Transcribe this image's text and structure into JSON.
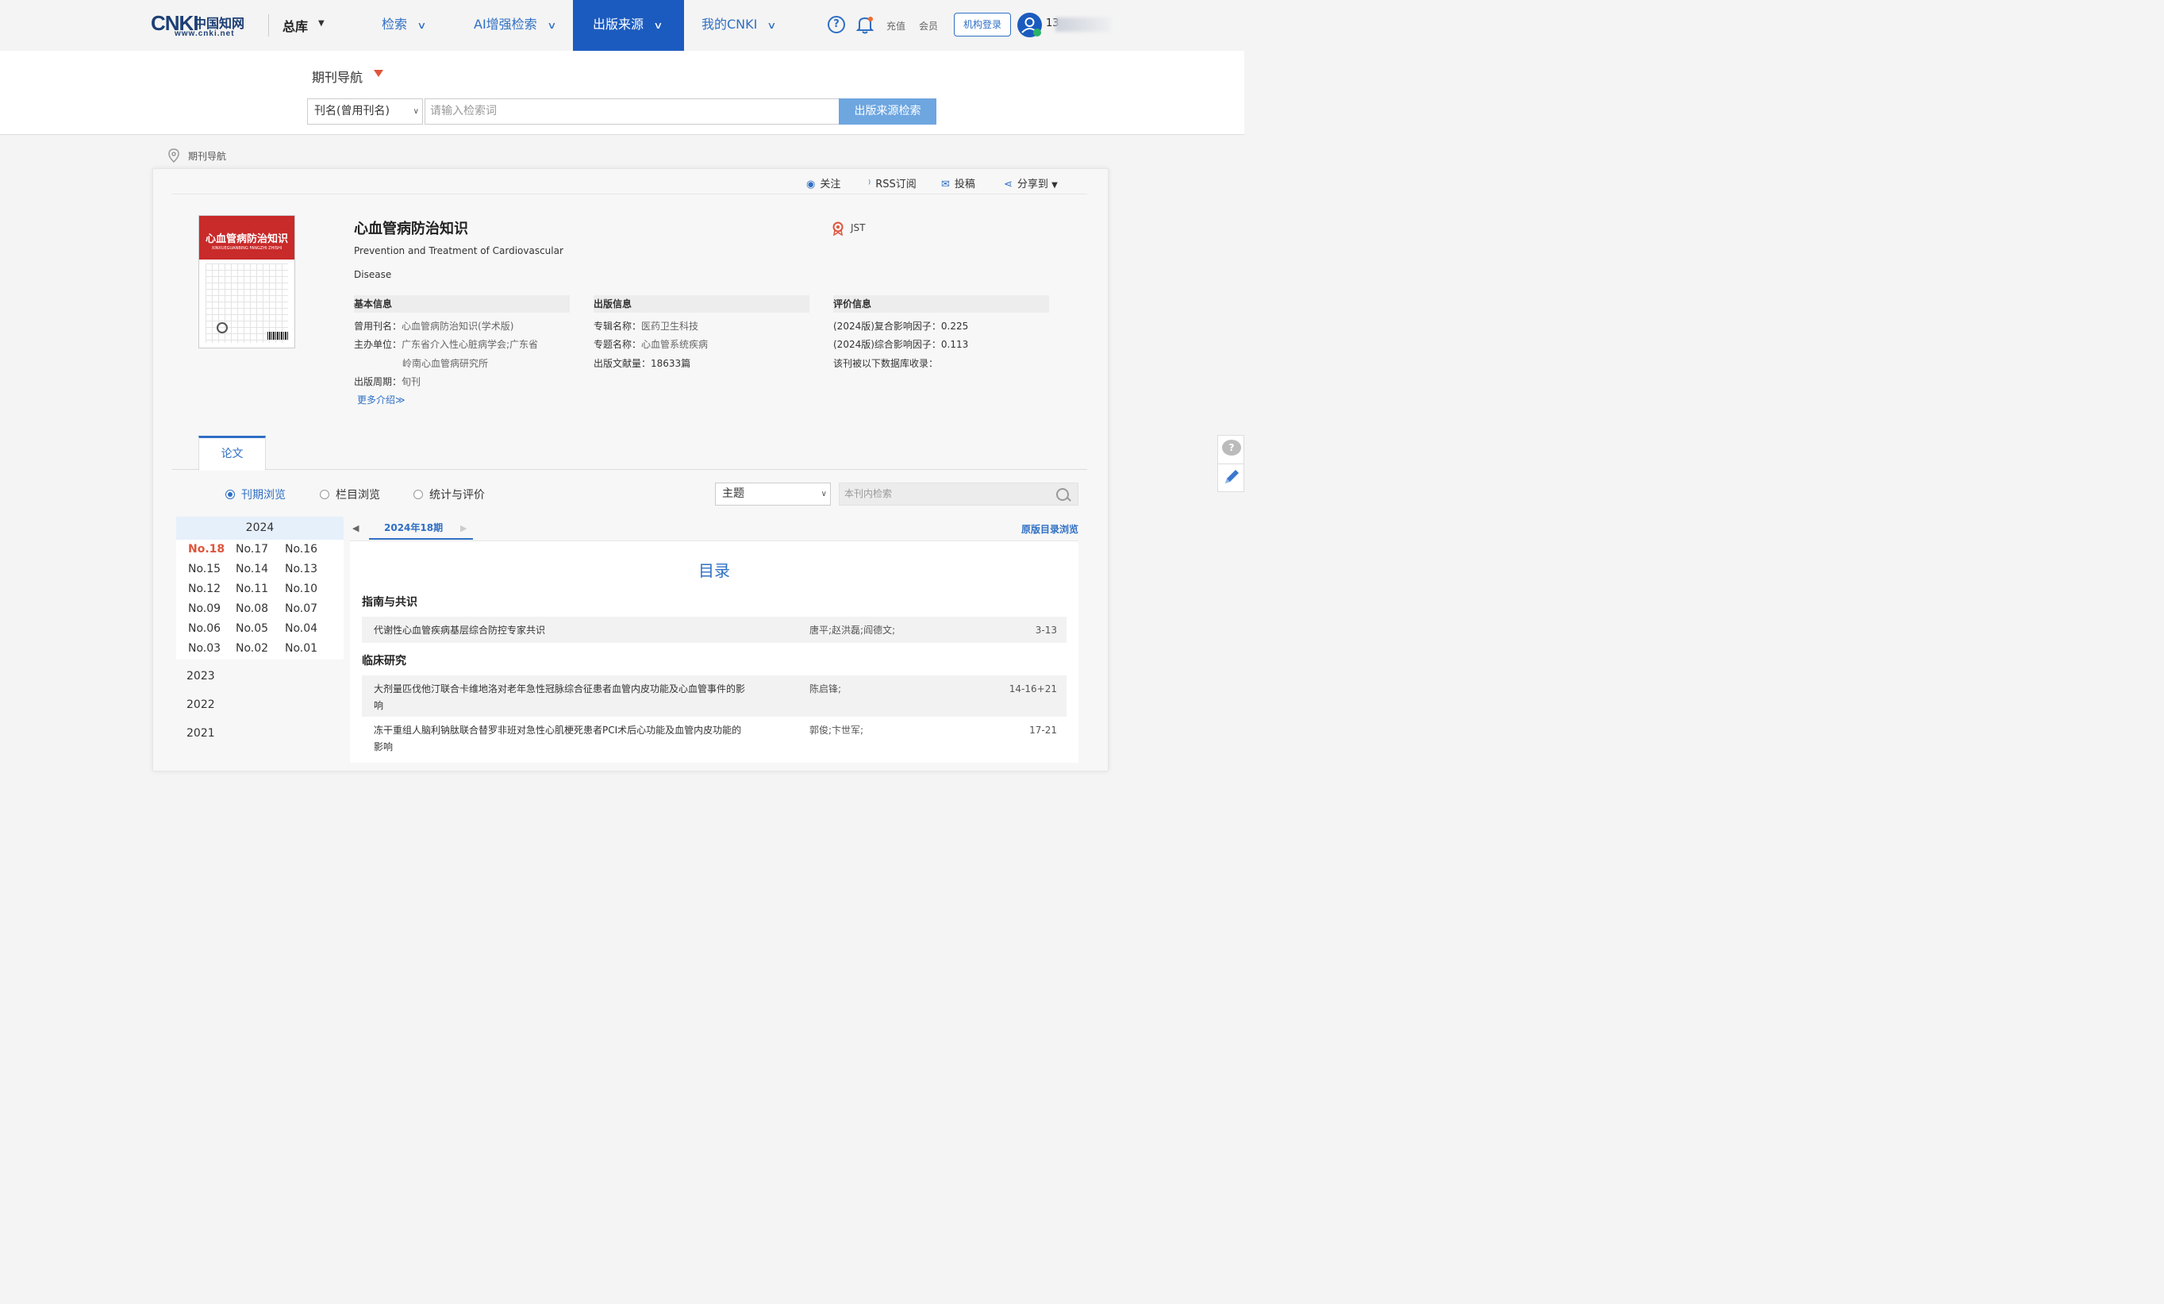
{
  "header": {
    "logo_text": "CNKI",
    "logo_cn": "中国知网",
    "logo_url": "www.cnki.net",
    "db_label": "总库",
    "nav": [
      {
        "label": "检索"
      },
      {
        "label": "AI增强检索"
      },
      {
        "label": "出版来源"
      },
      {
        "label": "我的CNKI"
      }
    ],
    "recharge": "充值",
    "member": "会员",
    "org_login": "机构登录",
    "username": "13"
  },
  "search": {
    "nav_label": "期刊导航",
    "field": "刊名(曾用刊名)",
    "placeholder": "请输入检索词",
    "button": "出版来源检索"
  },
  "breadcrumb": "期刊导航",
  "toolbar": {
    "follow": "关注",
    "rss": "RSS订阅",
    "submit": "投稿",
    "share": "分享到"
  },
  "journal": {
    "cover_title": "心血管病防治知识",
    "cover_pinyin": "XINXUEGUANBING FANGZHI ZHISHI",
    "title": "心血管病防治知识",
    "title_en_line1": "Prevention and Treatment of Cardiovascular",
    "title_en_line2": "Disease",
    "badge": "JST",
    "basic": {
      "heading": "基本信息",
      "former_name_label": "曾用刊名：",
      "former_name": "心血管病防治知识(学术版)",
      "sponsor_label": "主办单位：",
      "sponsor_line1": "广东省介入性心脏病学会;广东省",
      "sponsor_line2": "岭南心血管病研究所",
      "cycle_label": "出版周期：",
      "cycle": "旬刊",
      "more": "更多介绍≫"
    },
    "publication": {
      "heading": "出版信息",
      "series_label": "专辑名称：",
      "series": "医药卫生科技",
      "topic_label": "专题名称：",
      "topic": "心血管系统疾病",
      "count_label": "出版文献量：",
      "count": "18633篇"
    },
    "evaluation": {
      "heading": "评价信息",
      "if1_label": "(2024版)复合影响因子：",
      "if1": "0.225",
      "if2_label": "(2024版)综合影响因子：",
      "if2": "0.113",
      "db_label": "该刊被以下数据库收录："
    }
  },
  "tabs": {
    "papers": "论文"
  },
  "browse": {
    "by_issue": "刊期浏览",
    "by_column": "栏目浏览",
    "stats": "统计与评价",
    "topic_select": "主题",
    "inner_placeholder": "本刊内检索"
  },
  "years": {
    "current": "2024",
    "issues": [
      "No.18",
      "No.17",
      "No.16",
      "No.15",
      "No.14",
      "No.13",
      "No.12",
      "No.11",
      "No.10",
      "No.09",
      "No.08",
      "No.07",
      "No.06",
      "No.05",
      "No.04",
      "No.03",
      "No.02",
      "No.01"
    ],
    "others": [
      "2023",
      "2022",
      "2021"
    ]
  },
  "toc": {
    "issue_label": "2024年18期",
    "orig_link": "原版目录浏览",
    "title": "目录",
    "sections": [
      {
        "name": "指南与共识"
      },
      {
        "name": "临床研究"
      }
    ],
    "articles": [
      {
        "title": "代谢性心血管疾病基层综合防控专家共识",
        "authors": "唐平;赵洪磊;阎德文;",
        "pages": "3-13"
      },
      {
        "title": "大剂量匹伐他汀联合卡维地洛对老年急性冠脉综合征患者血管内皮功能及心血管事件的影响",
        "authors": "陈启锋;",
        "pages": "14-16+21"
      },
      {
        "title": "冻干重组人脑利钠肽联合替罗非班对急性心肌梗死患者PCI术后心功能及血管内皮功能的影响",
        "authors": "郭俊;卞世军;",
        "pages": "17-21"
      }
    ]
  },
  "float": {
    "feedback": "?"
  }
}
